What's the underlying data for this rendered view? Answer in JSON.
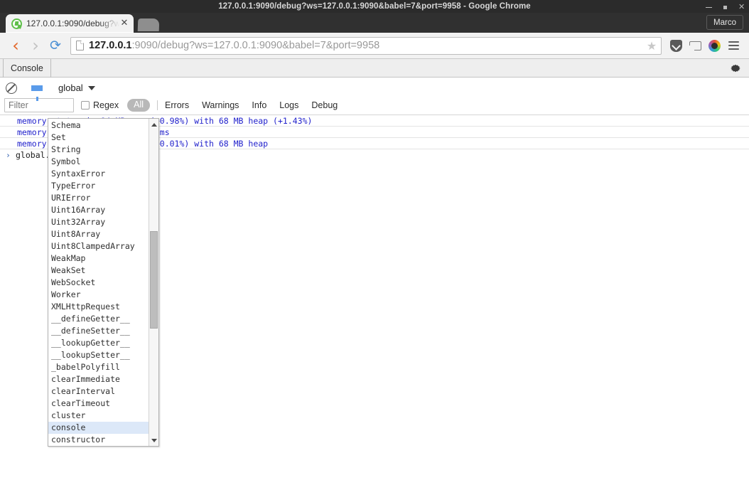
{
  "window": {
    "title": "127.0.0.1:9090/debug?ws=127.0.0.1:9090&babel=7&port=9958 - Google Chrome",
    "controls": {
      "minimize": "–",
      "maximize": "▪",
      "close": "✕"
    }
  },
  "tabstrip": {
    "tab_title": "127.0.0.1:9090/debug?w",
    "tab_close": "✕",
    "favicon": "node-debug-favicon",
    "new_tab": "new-tab-button",
    "profile_label": "Marco"
  },
  "navbar": {
    "back": "‹",
    "forward": "›",
    "reload": "⟳",
    "page_icon": "page-document-icon",
    "url_host": "127.0.0.1",
    "url_rest": ":9090/debug?ws=127.0.0.1:9090&babel=7&port=9958",
    "url_full": "127.0.0.1:9090/debug?ws=127.0.0.1:9090&babel=7&port=9958",
    "star": "★",
    "icons": [
      "pocket-icon",
      "cast-icon",
      "extension-icon",
      "chrome-menu-icon"
    ]
  },
  "devtools": {
    "panel_tab": "Console",
    "gear": "settings-gear-icon",
    "toolbar": {
      "clear_icon": "clear-console-icon",
      "filter_icon": "filter-funnel-icon",
      "context_label": "global",
      "context_caret": "▼",
      "filter_placeholder": "Filter",
      "filter_value": "",
      "regex_label": "Regex",
      "regex_checked": false,
      "levels": [
        "All",
        "Errors",
        "Warnings",
        "Info",
        "Logs",
        "Debug"
      ],
      "active_level": "All"
    }
  },
  "console": {
    "logs": [
      "memory status is 94 MB ram (+0.98%) with 68 MB heap (+1.43%)",
      "memory garbage collected in 0ms",
      "memory status is 94 MB ram (+0.01%) with 68 MB heap"
    ],
    "prompt_chevron": "›",
    "input_typed": "global.",
    "input_completion": "console"
  },
  "autocomplete": {
    "selected": "console",
    "items": [
      "Schema",
      "Set",
      "String",
      "Symbol",
      "SyntaxError",
      "TypeError",
      "URIError",
      "Uint16Array",
      "Uint32Array",
      "Uint8Array",
      "Uint8ClampedArray",
      "WeakMap",
      "WeakSet",
      "WebSocket",
      "Worker",
      "XMLHttpRequest",
      "__defineGetter__",
      "__defineSetter__",
      "__lookupGetter__",
      "__lookupSetter__",
      "_babelPolyfill",
      "clearImmediate",
      "clearInterval",
      "clearTimeout",
      "cluster",
      "console",
      "constructor"
    ],
    "scroll_up": "▲",
    "scroll_down": "▼"
  },
  "colors": {
    "titlebar_bg": "#2b2b2b",
    "tabstrip_bg": "#303030",
    "toolbar_bg": "#f2f2f2",
    "log_text": "#2222cc",
    "completion_bg": "#dd3322",
    "selected_row_bg": "#dce8f8",
    "filter_icon": "#5a9bea",
    "back_arrow": "#e2672a",
    "reload_icon": "#4b8fd4"
  }
}
